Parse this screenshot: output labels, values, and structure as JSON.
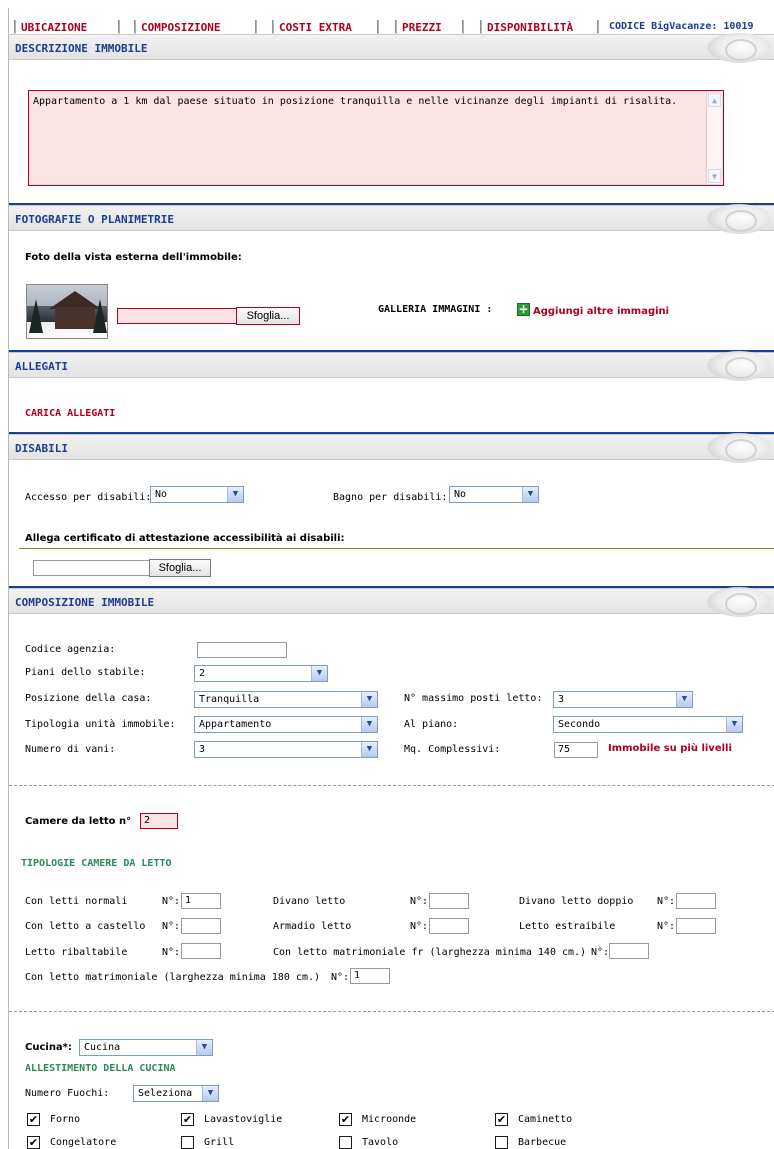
{
  "tabs": [
    "UBICAZIONE",
    "COMPOSIZIONE",
    "COSTI EXTRA",
    "PREZZI",
    "DISPONIBILITÀ"
  ],
  "codice": "CODICE BigVacanze: 10019",
  "sections": {
    "descrizione": "DESCRIZIONE IMMOBILE",
    "fotografie": "FOTOGRAFIE O PLANIMETRIE",
    "allegati": "ALLEGATI",
    "disabili": "DISABILI",
    "composizione": "COMPOSIZIONE IMMOBILE"
  },
  "descrizione_text": "Appartamento a 1 km dal paese situato in posizione tranquilla e nelle vicinanze degli impianti di risalita.",
  "foto": {
    "label": "Foto della vista esterna dell'immobile:",
    "browse": "Sfoglia...",
    "galleria_label": "GALLERIA IMMAGINI :",
    "aggiungi": "Aggiungi altre immagini"
  },
  "allegati": {
    "carica": "CARICA ALLEGATI"
  },
  "disabili": {
    "accesso_label": "Accesso per disabili:",
    "accesso_value": "No",
    "bagno_label": "Bagno per disabili:",
    "bagno_value": "No",
    "certificato_label": "Allega certificato di attestazione accessibilità ai disabili:",
    "browse": "Sfoglia..."
  },
  "composizione": {
    "codice_agenzia_label": "Codice agenzia:",
    "codice_agenzia_value": "",
    "piani_label": "Piani dello stabile:",
    "piani_value": "2",
    "posizione_label": "Posizione della casa:",
    "posizione_value": "Tranquilla",
    "posti_label": "N° massimo posti letto:",
    "posti_value": "3",
    "tipologia_label": "Tipologia unità immobile:",
    "tipologia_value": "Appartamento",
    "al_piano_label": "Al piano:",
    "al_piano_value": "Secondo",
    "vani_label": "Numero di vani:",
    "vani_value": "3",
    "mq_label": "Mq. Complessivi:",
    "mq_value": "75",
    "livelli": "Immobile su più livelli"
  },
  "camere": {
    "label": "Camere da letto n°",
    "value": "2",
    "tipologie_title": "TIPOLOGIE CAMERE DA LETTO",
    "n_label": "N°:",
    "items": [
      {
        "label": "Con letti normali",
        "value": "1"
      },
      {
        "label": "Divano letto",
        "value": ""
      },
      {
        "label": "Divano letto doppio",
        "value": ""
      },
      {
        "label": "Con letto a castello",
        "value": ""
      },
      {
        "label": "Armadio letto",
        "value": ""
      },
      {
        "label": "Letto estraibile",
        "value": ""
      },
      {
        "label": "Letto ribaltabile",
        "value": ""
      },
      {
        "label": "Con letto matrimoniale fr (larghezza minima 140 cm.)",
        "value": ""
      },
      {
        "label": "Con letto matrimoniale (larghezza minima 180 cm.)",
        "value": "1"
      }
    ]
  },
  "cucina": {
    "label": "Cucina*:",
    "value": "Cucina",
    "allestimento_title": "ALLESTIMENTO DELLA CUCINA",
    "fuochi_label": "Numero Fuochi:",
    "fuochi_value": "Seleziona",
    "checks": [
      {
        "label": "Forno",
        "checked": true
      },
      {
        "label": "Lavastoviglie",
        "checked": true
      },
      {
        "label": "Microonde",
        "checked": true
      },
      {
        "label": "Caminetto",
        "checked": true
      },
      {
        "label": "Congelatore",
        "checked": true
      },
      {
        "label": "Grill",
        "checked": false
      },
      {
        "label": "Tavolo",
        "checked": false
      },
      {
        "label": "Barbecue",
        "checked": false
      }
    ]
  },
  "colors": {
    "accent_red": "#b0001e",
    "section_blue": "#1d3d8f",
    "field_pink": "#fbe3e3",
    "green": "#2b8a5d"
  }
}
